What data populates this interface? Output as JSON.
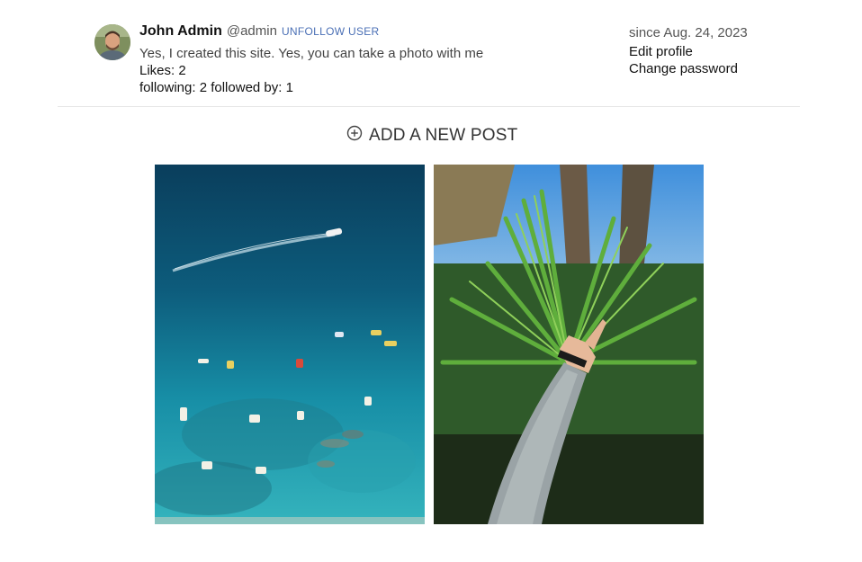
{
  "profile": {
    "name": "John Admin",
    "handle": "@admin",
    "unfollow_label": "UNFOLLOW USER",
    "bio": "Yes, I created this site. Yes, you can take a photo with me",
    "likes": "Likes: 2",
    "following": "following: 2",
    "followed_by": "followed by: 1",
    "since": "since Aug. 24, 2023",
    "edit_profile": "Edit profile",
    "change_password": "Change password"
  },
  "actions": {
    "add_post_label": "ADD A NEW POST",
    "add_post_icon": "plus-circle-icon"
  },
  "posts": [
    {
      "subject": "aerial view of boats on turquoise sea"
    },
    {
      "subject": "arm reaching into palm leaves"
    }
  ]
}
